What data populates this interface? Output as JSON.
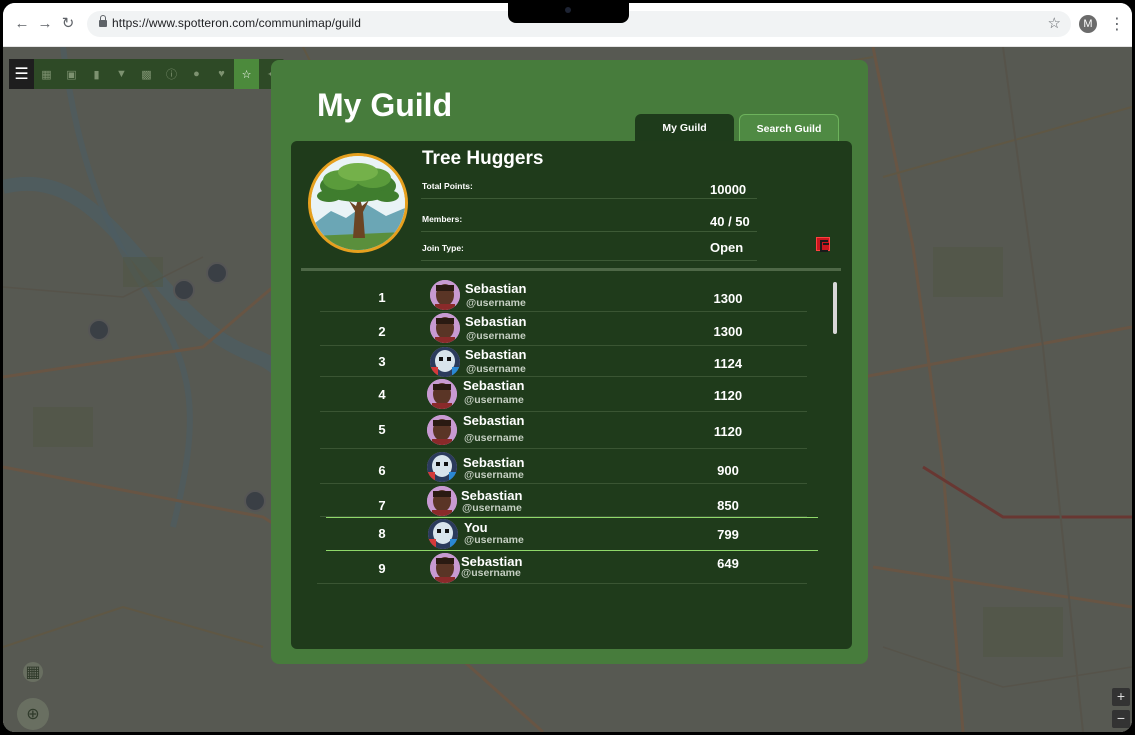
{
  "browser": {
    "url": "https://www.spotteron.com/communimap/guild",
    "profile_initial": "M"
  },
  "toolbar": {
    "icons": [
      "menu-icon",
      "grid-icon",
      "bookmark-icon",
      "chart-icon",
      "filter-icon",
      "binoculars-icon",
      "info-icon",
      "person-icon",
      "heart-icon",
      "guild-icon",
      "bolt-icon"
    ]
  },
  "panel": {
    "title": "My Guild",
    "tabs": [
      {
        "label": "My Guild",
        "active": true
      },
      {
        "label": "Search Guild",
        "active": false
      }
    ]
  },
  "guild": {
    "name": "Tree Huggers",
    "stats": [
      {
        "label": "Total Points:",
        "value": "10000"
      },
      {
        "label": "Members:",
        "value": "40 / 50"
      },
      {
        "label": "Join Type:",
        "value": "Open"
      }
    ]
  },
  "members": [
    {
      "rank": "1",
      "name": "Sebastian",
      "username": "@username",
      "score": "1300",
      "avatar": "avatar-portrait"
    },
    {
      "rank": "2",
      "name": "Sebastian",
      "username": "@username",
      "score": "1300",
      "avatar": "avatar-portrait"
    },
    {
      "rank": "3",
      "name": "Sebastian",
      "username": "@username",
      "score": "1124",
      "avatar": "avatar-masked"
    },
    {
      "rank": "4",
      "name": "Sebastian",
      "username": "@username",
      "score": "1120",
      "avatar": "avatar-portrait"
    },
    {
      "rank": "5",
      "name": "Sebastian",
      "username": "@username",
      "score": "1120",
      "avatar": "avatar-portrait"
    },
    {
      "rank": "6",
      "name": "Sebastian",
      "username": "@username",
      "score": "900",
      "avatar": "avatar-masked"
    },
    {
      "rank": "7",
      "name": "Sebastian",
      "username": "@username",
      "score": "850",
      "avatar": "avatar-portrait"
    },
    {
      "rank": "8",
      "name": "You",
      "username": "@username",
      "score": "799",
      "avatar": "avatar-masked",
      "is_you": true
    },
    {
      "rank": "9",
      "name": "Sebastian",
      "username": "@username",
      "score": "649",
      "avatar": "avatar-portrait"
    }
  ],
  "map_controls": {
    "zoom_in": "+",
    "zoom_out": "−"
  },
  "colors": {
    "panel_green": "#477c3c",
    "inner_dark_green": "#1f3b1b",
    "highlight_row": "#8fd86a",
    "leave_red": "#c8161e"
  }
}
